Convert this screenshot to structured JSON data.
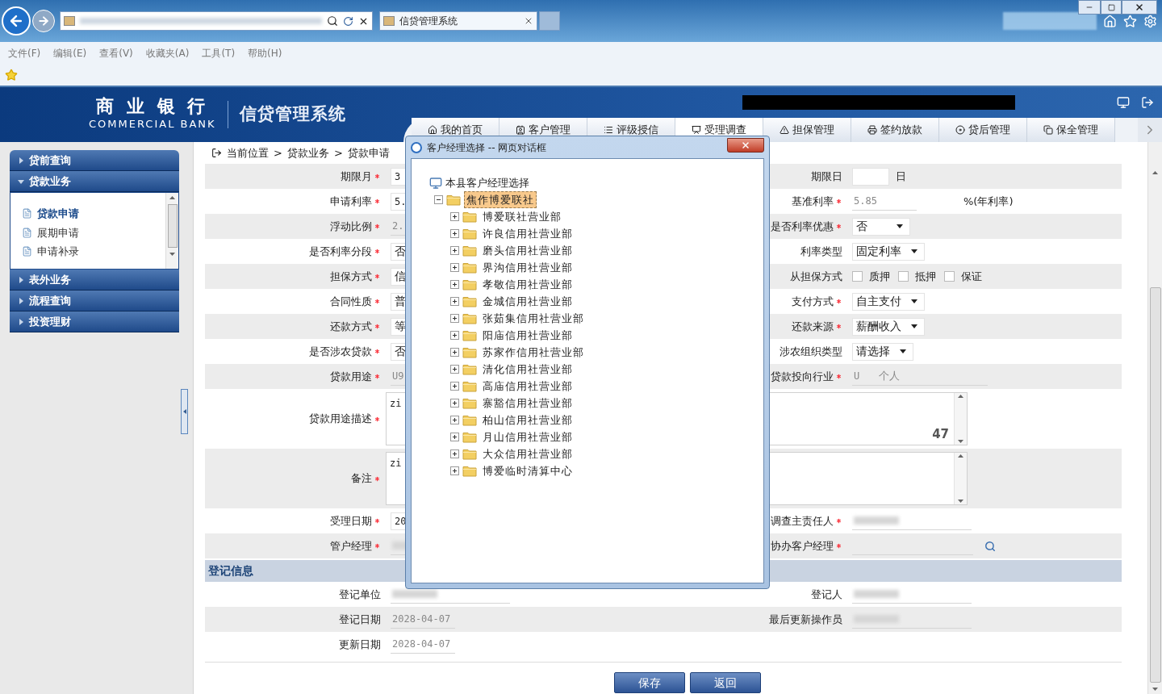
{
  "browser": {
    "tab_title": "信贷管理系统",
    "menu": [
      "文件(F)",
      "编辑(E)",
      "查看(V)",
      "收藏夹(A)",
      "工具(T)",
      "帮助(H)"
    ]
  },
  "header": {
    "bank_name": "商 业 银 行",
    "bank_name_en": "COMMERCIAL BANK",
    "system_name": "信贷管理系统"
  },
  "nav_tabs": [
    {
      "label": "我的首页",
      "selected": false
    },
    {
      "label": "客户管理",
      "selected": false
    },
    {
      "label": "评级授信",
      "selected": false
    },
    {
      "label": "受理调查",
      "selected": true
    },
    {
      "label": "担保管理",
      "selected": false
    },
    {
      "label": "签约放款",
      "selected": false
    },
    {
      "label": "贷后管理",
      "selected": false
    },
    {
      "label": "保全管理",
      "selected": false
    }
  ],
  "sidebar": {
    "sections": [
      {
        "label": "贷前查询",
        "expanded": false
      },
      {
        "label": "贷款业务",
        "expanded": true,
        "items": [
          {
            "label": "贷款申请",
            "selected": true
          },
          {
            "label": "展期申请",
            "selected": false
          },
          {
            "label": "申请补录",
            "selected": false
          }
        ]
      },
      {
        "label": "表外业务",
        "expanded": false
      },
      {
        "label": "流程查询",
        "expanded": false
      },
      {
        "label": "投资理财",
        "expanded": false
      }
    ]
  },
  "breadcrumb": [
    "当前位置",
    ">",
    "贷款业务",
    ">",
    "贷款申请"
  ],
  "form": {
    "rows": [
      {
        "kind": "pair",
        "left": {
          "label": "期限月",
          "required": true,
          "kind": "input",
          "value": "3"
        },
        "right": {
          "label": "期限日",
          "required": false,
          "kind": "input",
          "suffix": "日"
        }
      },
      {
        "kind": "pair",
        "left": {
          "label": "申请利率",
          "required": true,
          "kind": "input",
          "value": "5."
        },
        "right": {
          "label": "基准利率",
          "required": true,
          "kind": "readonly",
          "value": "5.85",
          "suffix": "%(年利率)"
        }
      },
      {
        "kind": "pair",
        "left": {
          "label": "浮动比例",
          "required": true,
          "kind": "readonly",
          "value": "2."
        },
        "right": {
          "label": "是否利率优惠",
          "required": true,
          "kind": "select",
          "value": "否"
        }
      },
      {
        "kind": "pair",
        "left": {
          "label": "是否利率分段",
          "required": true,
          "kind": "select",
          "value": "否"
        },
        "right": {
          "label": "利率类型",
          "required": false,
          "kind": "select",
          "value": "固定利率"
        }
      },
      {
        "kind": "pair",
        "left": {
          "label": "担保方式",
          "required": true,
          "kind": "select",
          "value": "信"
        },
        "right": {
          "label": "从担保方式",
          "required": false,
          "kind": "checks",
          "options": [
            {
              "label": "质押",
              "checked": false
            },
            {
              "label": "抵押",
              "checked": false
            },
            {
              "label": "保证",
              "checked": false
            }
          ]
        }
      },
      {
        "kind": "pair",
        "left": {
          "label": "合同性质",
          "required": true,
          "kind": "select",
          "value": "普"
        },
        "right": {
          "label": "支付方式",
          "required": true,
          "kind": "select",
          "value": "自主支付"
        }
      },
      {
        "kind": "pair",
        "left": {
          "label": "还款方式",
          "required": true,
          "kind": "select",
          "value": "等"
        },
        "right": {
          "label": "还款来源",
          "required": true,
          "kind": "select",
          "value": "薪酬收入"
        }
      },
      {
        "kind": "pair",
        "left": {
          "label": "是否涉农贷款",
          "required": true,
          "kind": "select",
          "value": "否"
        },
        "right": {
          "label": "涉农组织类型",
          "required": false,
          "kind": "select",
          "value": "请选择"
        }
      },
      {
        "kind": "pair",
        "left": {
          "label": "贷款用途",
          "required": true,
          "kind": "readonly",
          "value": "U9"
        },
        "right": {
          "label": "贷款投向行业",
          "required": true,
          "kind": "code_name",
          "value": "U",
          "name": "个人"
        }
      },
      {
        "kind": "textarea",
        "label": "贷款用途描述",
        "required": true,
        "value": "zi",
        "counter": "47"
      },
      {
        "kind": "textarea",
        "label": "备注",
        "required": true,
        "value": "zi"
      },
      {
        "kind": "pair",
        "left": {
          "label": "受理日期",
          "required": true,
          "kind": "input",
          "value": "20"
        },
        "right": {
          "label": "调查主责任人",
          "required": true,
          "kind": "blurred"
        }
      },
      {
        "kind": "pair",
        "left": {
          "label": "管户经理",
          "required": true,
          "kind": "blurred"
        },
        "right": {
          "label": "协办客户经理",
          "required": true,
          "kind": "search"
        }
      }
    ]
  },
  "registration": {
    "title": "登记信息",
    "rows": [
      {
        "left": {
          "label": "登记单位",
          "required": false,
          "kind": "blurred"
        },
        "right": {
          "label": "登记人",
          "required": false,
          "kind": "blurred"
        }
      },
      {
        "left": {
          "label": "登记日期",
          "required": false,
          "kind": "readonly",
          "value": "2028-04-07"
        },
        "right": {
          "label": "最后更新操作员",
          "required": false,
          "kind": "blurred"
        }
      },
      {
        "left": {
          "label": "更新日期",
          "required": false,
          "kind": "readonly",
          "value": "2028-04-07"
        }
      }
    ]
  },
  "buttons": [
    "保存",
    "返回"
  ],
  "dialog": {
    "title": "客户经理选择 -- 网页对话框",
    "tree": {
      "label": "本县客户经理选择",
      "children": [
        {
          "label": "焦作博爱联社",
          "expanded": true,
          "selected": true,
          "children": [
            {
              "label": "博爱联社营业部",
              "expanded": false,
              "selected": false
            },
            {
              "label": "许良信用社营业部",
              "expanded": false,
              "selected": false
            },
            {
              "label": "磨头信用社营业部",
              "expanded": false,
              "selected": false
            },
            {
              "label": "界沟信用社营业部",
              "expanded": false,
              "selected": false
            },
            {
              "label": "孝敬信用社营业部",
              "expanded": false,
              "selected": false
            },
            {
              "label": "金城信用社营业部",
              "expanded": false,
              "selected": false
            },
            {
              "label": "张茹集信用社营业部",
              "expanded": false,
              "selected": false
            },
            {
              "label": "阳庙信用社营业部",
              "expanded": false,
              "selected": false
            },
            {
              "label": "苏家作信用社营业部",
              "expanded": false,
              "selected": false
            },
            {
              "label": "清化信用社营业部",
              "expanded": false,
              "selected": false
            },
            {
              "label": "高庙信用社营业部",
              "expanded": false,
              "selected": false
            },
            {
              "label": "寨豁信用社营业部",
              "expanded": false,
              "selected": false
            },
            {
              "label": "柏山信用社营业部",
              "expanded": false,
              "selected": false
            },
            {
              "label": "月山信用社营业部",
              "expanded": false,
              "selected": false
            },
            {
              "label": "大众信用社营业部",
              "expanded": false,
              "selected": false
            },
            {
              "label": "博爱临时清算中心",
              "expanded": false,
              "selected": false
            }
          ]
        }
      ]
    }
  }
}
